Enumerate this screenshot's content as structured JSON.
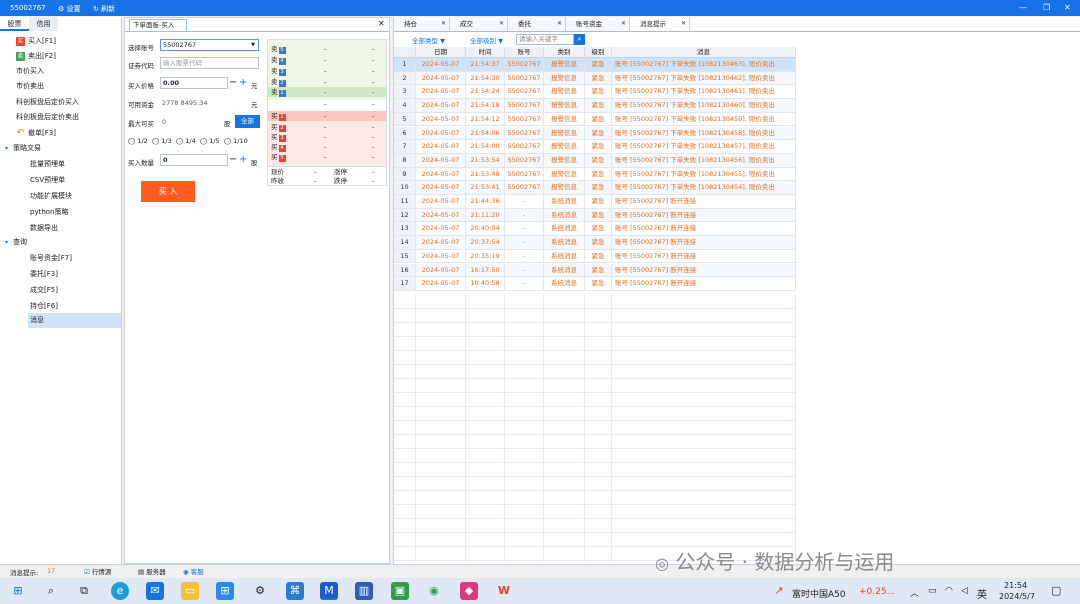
{
  "app": {
    "title": "55002767",
    "settings_label": "设置",
    "refresh_label": "刷新",
    "colors": {
      "accent": "#1673e6",
      "buy_red": "#e8432e",
      "sell_green": "#3aa34c",
      "buy_button": "#ff5a1f",
      "message_orange": "#e07020"
    }
  },
  "left": {
    "tabs": [
      "股票",
      "信用"
    ],
    "items": [
      {
        "label": "买入[F1]",
        "icon": "buy-icon",
        "badge": "买"
      },
      {
        "label": "卖出[F2]",
        "icon": "sell-icon",
        "badge": "卖"
      },
      {
        "label": "市价买入"
      },
      {
        "label": "市价卖出"
      },
      {
        "label": "科创板盘后定价买入"
      },
      {
        "label": "科创板盘后定价卖出"
      },
      {
        "label": "撤单[F3]",
        "icon": "undo-icon"
      }
    ],
    "strategy_group": "策略交易",
    "strategy_items": [
      "批量预埋单",
      "CSV预埋单",
      "功能扩展模块",
      "python策略",
      "数据导出"
    ],
    "query_group": "查询",
    "query_items": [
      "账号资金[F7]",
      "委托[F3]",
      "成交[F5]",
      "持仓[F6]",
      "消息"
    ]
  },
  "order": {
    "tab": "下单面板-买入",
    "labels": {
      "account": "选择账号",
      "code": "证券代码",
      "price": "买入价格",
      "funds": "可用资金",
      "maxbuy": "最大可买",
      "qty": "买入数量"
    },
    "account_value": "55002767",
    "code_placeholder": "输入股票代码",
    "price_value": "0.00",
    "price_unit": "元",
    "funds_value": "2778 8495.34",
    "funds_unit": "元",
    "maxbuy_value": "0",
    "maxbuy_unit": "股",
    "all_label": "全部",
    "fractions": [
      "1/2",
      "1/3",
      "1/4",
      "1/5",
      "1/10"
    ],
    "qty_value": "0",
    "qty_unit": "股",
    "buy_button": "买 入"
  },
  "quote": {
    "sells": [
      {
        "name": "卖",
        "n": "5"
      },
      {
        "name": "卖",
        "n": "4"
      },
      {
        "name": "卖",
        "n": "3"
      },
      {
        "name": "卖",
        "n": "2"
      },
      {
        "name": "卖",
        "n": "1"
      }
    ],
    "buys": [
      {
        "name": "买",
        "n": "1"
      },
      {
        "name": "买",
        "n": "2"
      },
      {
        "name": "买",
        "n": "3"
      },
      {
        "name": "买",
        "n": "4"
      },
      {
        "name": "买",
        "n": "5"
      }
    ],
    "dash": "-",
    "last_label": "现价",
    "rise_label": "涨停",
    "close_label": "昨收",
    "fall_label": "跌停"
  },
  "right": {
    "tabs": [
      "持仓",
      "成交",
      "委托",
      "账号资金",
      "消息提示"
    ],
    "filters": {
      "type": "全部类型",
      "level": "全部级别",
      "search_placeholder": "请输入关键字"
    },
    "columns": [
      "",
      "日期",
      "时间",
      "账号",
      "类别",
      "级别",
      "消息"
    ],
    "rows": [
      {
        "no": "1",
        "date": "2024-05-07",
        "time": "21:54:37",
        "acct": "55002767",
        "cat": "报警信息",
        "lvl": "紧急",
        "msg": "账号 [55002767] 下单失败 [1082130463], 限价卖出"
      },
      {
        "no": "2",
        "date": "2024-05-07",
        "time": "21:54:30",
        "acct": "55002767",
        "cat": "报警信息",
        "lvl": "紧急",
        "msg": "账号 [55002767] 下单失败 [1082130462], 限价卖出"
      },
      {
        "no": "3",
        "date": "2024-05-07",
        "time": "21:54:24",
        "acct": "55002767",
        "cat": "报警信息",
        "lvl": "紧急",
        "msg": "账号 [55002767] 下单失败 [1082130461], 限价卖出"
      },
      {
        "no": "4",
        "date": "2024-05-07",
        "time": "21:54:18",
        "acct": "55002767",
        "cat": "报警信息",
        "lvl": "紧急",
        "msg": "账号 [55002767] 下单失败 [1082130460], 限价卖出"
      },
      {
        "no": "5",
        "date": "2024-05-07",
        "time": "21:54:12",
        "acct": "55002767",
        "cat": "报警信息",
        "lvl": "紧急",
        "msg": "账号 [55002767] 下单失败 [1082130459], 限价卖出"
      },
      {
        "no": "6",
        "date": "2024-05-07",
        "time": "21:54:06",
        "acct": "55002767",
        "cat": "报警信息",
        "lvl": "紧急",
        "msg": "账号 [55002767] 下单失败 [1082130458], 限价卖出"
      },
      {
        "no": "7",
        "date": "2024-05-07",
        "time": "21:54:00",
        "acct": "55002767",
        "cat": "报警信息",
        "lvl": "紧急",
        "msg": "账号 [55002767] 下单失败 [1082130457], 限价卖出"
      },
      {
        "no": "8",
        "date": "2024-05-07",
        "time": "21:53:54",
        "acct": "55002767",
        "cat": "报警信息",
        "lvl": "紧急",
        "msg": "账号 [55002767] 下单失败 [1082130456], 限价卖出"
      },
      {
        "no": "9",
        "date": "2024-05-07",
        "time": "21:53:48",
        "acct": "55002767",
        "cat": "报警信息",
        "lvl": "紧急",
        "msg": "账号 [55002767] 下单失败 [1082130455], 限价卖出"
      },
      {
        "no": "10",
        "date": "2024-05-07",
        "time": "21:53:41",
        "acct": "55002767",
        "cat": "报警信息",
        "lvl": "紧急",
        "msg": "账号 [55002767] 下单失败 [1082130454], 限价卖出"
      },
      {
        "no": "11",
        "date": "2024-05-07",
        "time": "21:44:36",
        "acct": "-",
        "cat": "系统消息",
        "lvl": "紧急",
        "msg": "账号 [55002767] 断开连接"
      },
      {
        "no": "12",
        "date": "2024-05-07",
        "time": "21:11:20",
        "acct": "-",
        "cat": "系统消息",
        "lvl": "紧急",
        "msg": "账号 [55002767] 断开连接"
      },
      {
        "no": "13",
        "date": "2024-05-07",
        "time": "20:40:04",
        "acct": "-",
        "cat": "系统消息",
        "lvl": "紧急",
        "msg": "账号 [55002767] 断开连接"
      },
      {
        "no": "14",
        "date": "2024-05-07",
        "time": "20:37:54",
        "acct": "-",
        "cat": "系统消息",
        "lvl": "紧急",
        "msg": "账号 [55002767] 断开连接"
      },
      {
        "no": "15",
        "date": "2024-05-07",
        "time": "20:35:19",
        "acct": "-",
        "cat": "系统消息",
        "lvl": "紧急",
        "msg": "账号 [55002767] 断开连接"
      },
      {
        "no": "16",
        "date": "2024-05-07",
        "time": "16:17:50",
        "acct": "-",
        "cat": "系统消息",
        "lvl": "紧急",
        "msg": "账号 [55002767] 断开连接"
      },
      {
        "no": "17",
        "date": "2024-05-07",
        "time": "10:40:58",
        "acct": "-",
        "cat": "系统消息",
        "lvl": "紧急",
        "msg": "账号 [55002767] 断开连接"
      }
    ]
  },
  "status": {
    "msg_label": "消息提示:",
    "msg_count": "17",
    "quote_src": "行情源",
    "server": "服务器",
    "service": "客服"
  },
  "watermark": "公众号 · 数据分析与运用",
  "taskbar": {
    "ticker": "富时中国A50",
    "ticker_change": "+0.25...",
    "ime": "英",
    "time": "21:54",
    "date": "2024/5/7"
  }
}
